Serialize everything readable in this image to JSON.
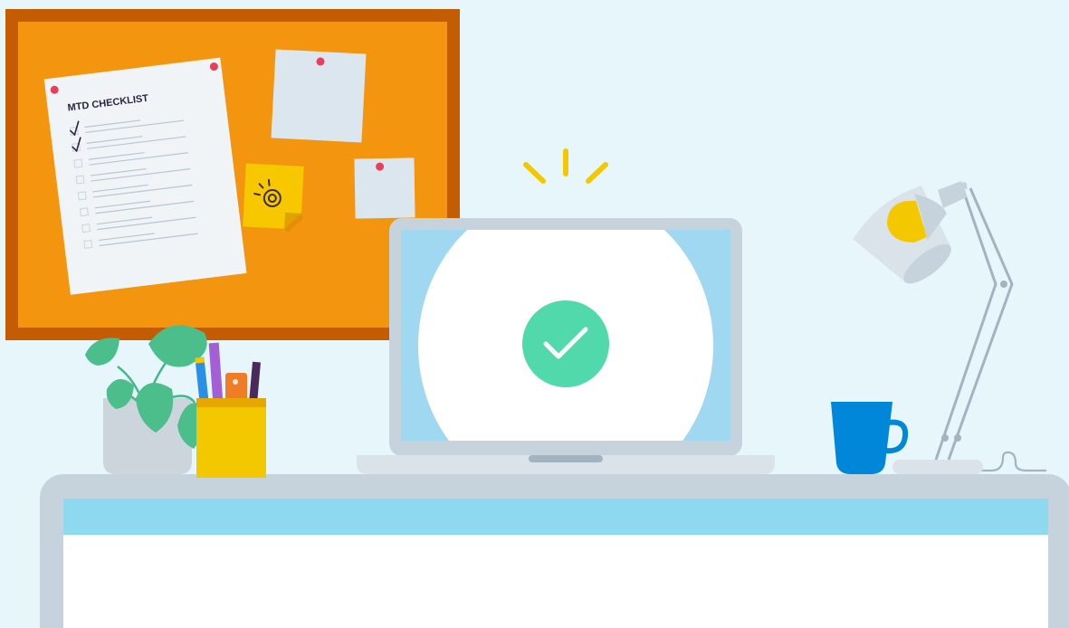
{
  "illustration": {
    "checklist_title": "MTD CHECKLIST",
    "checklist_items_checked": [
      true,
      true,
      false,
      false,
      false,
      false,
      false,
      false
    ],
    "screen_status_icon": "checkmark-icon",
    "colors": {
      "background": "#e6f6fb",
      "corkboard": "#f3950f",
      "corkboard_frame": "#c45c04",
      "success_green": "#52d9ab",
      "screen_blue": "#a0d8f2",
      "desk_blue": "#8fd9f0",
      "desk_gray": "#c6d3dc",
      "mug_blue": "#0087d9",
      "pen_holder_yellow": "#f4c800",
      "lamp_bulb_yellow": "#f4c800"
    }
  }
}
